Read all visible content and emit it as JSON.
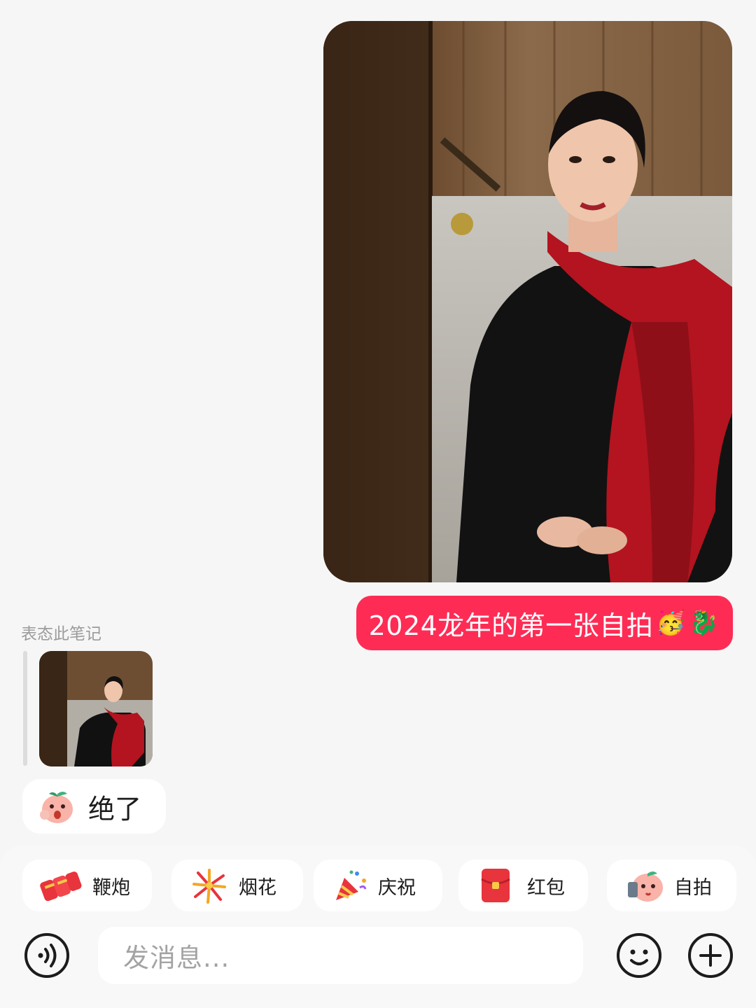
{
  "message": {
    "text": "2024龙年的第一张自拍",
    "emoji_1": "🥳",
    "emoji_2": "🐉",
    "image": "selfie-photo"
  },
  "reaction": {
    "label": "表态此笔记",
    "reply_text": "绝了",
    "reply_icon": "surprised-peach-sticker"
  },
  "quick_actions": [
    {
      "label": "鞭炮",
      "icon": "firecracker-icon"
    },
    {
      "label": "烟花",
      "icon": "firework-icon"
    },
    {
      "label": "庆祝",
      "icon": "party-popper-icon"
    },
    {
      "label": "红包",
      "icon": "red-envelope-icon"
    },
    {
      "label": "自拍",
      "icon": "selfie-peach-icon"
    }
  ],
  "input": {
    "placeholder": "发消息..."
  },
  "colors": {
    "accent": "#fe2c55",
    "background": "#f6f6f6"
  }
}
